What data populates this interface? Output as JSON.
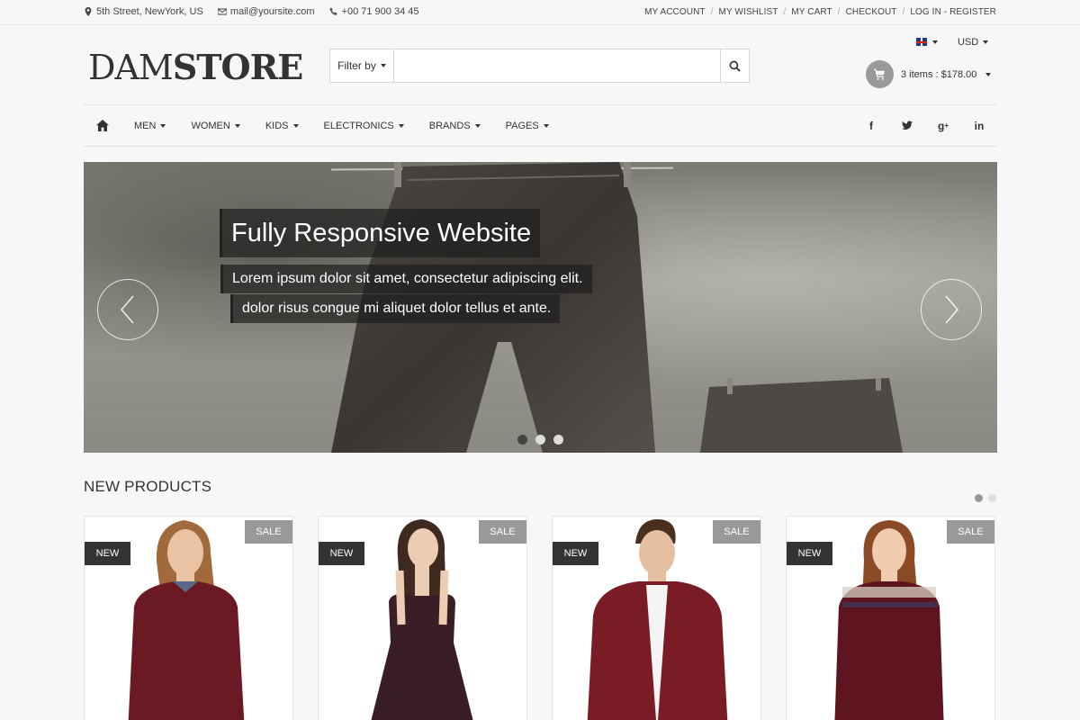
{
  "topbar": {
    "address": "5th Street, NewYork, US",
    "email": "mail@yoursite.com",
    "phone": "+00 71 900 34 45",
    "links": [
      "MY ACCOUNT",
      "MY WISHLIST",
      "MY CART",
      "CHECKOUT",
      "LOG IN - REGISTER"
    ]
  },
  "header": {
    "logo_light": "DAM",
    "logo_bold": "STORE",
    "filter_label": "Filter by",
    "search_placeholder": "",
    "currency": "USD",
    "cart_summary": "3 items : $178.00"
  },
  "nav": {
    "items": [
      "MEN",
      "WOMEN",
      "KIDS",
      "ELECTRONICS",
      "BRANDS",
      "PAGES"
    ],
    "social": [
      "facebook-icon",
      "twitter-icon",
      "google-plus-icon",
      "linkedin-icon"
    ]
  },
  "hero": {
    "caption1": "Fully Responsive Website",
    "caption2": "Lorem ipsum dolor sit amet, consectetur adipiscing elit.",
    "caption3": "dolor risus congue mi aliquet dolor tellus et ante.",
    "slides": 3,
    "active_slide": 1
  },
  "products": {
    "title": "NEW PRODUCTS",
    "pages": 2,
    "active_page": 1,
    "items": [
      {
        "new_label": "NEW",
        "sale_label": "SALE"
      },
      {
        "new_label": "NEW",
        "sale_label": "SALE"
      },
      {
        "new_label": "NEW",
        "sale_label": "SALE"
      },
      {
        "new_label": "NEW",
        "sale_label": "SALE"
      }
    ]
  },
  "colors": {
    "background": "#f7f7f7",
    "dark": "#333333",
    "sale_badge": "#999999",
    "garment": "#6b1a24"
  }
}
